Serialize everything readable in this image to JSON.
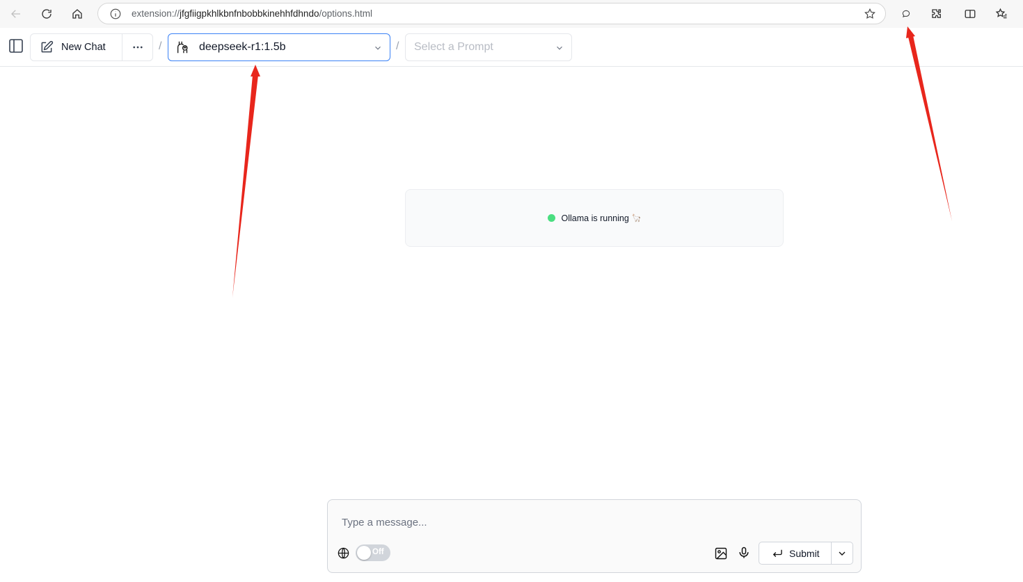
{
  "browser": {
    "url_prefix": "extension://",
    "url_host": "jfgfiigpkhlkbnfnbobbkinehhfdhndo",
    "url_path": "/options.html"
  },
  "header": {
    "new_chat_label": "New Chat",
    "breadcrumb_separator": "/",
    "model_label": "deepseek-r1:1.5b",
    "prompt_placeholder": "Select a Prompt"
  },
  "status": {
    "text": "Ollama is running",
    "emoji": "🦙",
    "color": "#4ade80"
  },
  "composer": {
    "placeholder": "Type a message...",
    "web_search_toggle_label": "Off",
    "submit_label": "Submit"
  },
  "colors": {
    "accent": "#3b82f6",
    "annotation_arrow": "#e8261c"
  },
  "icons": {
    "sidebar": "sidebar-icon",
    "new_chat": "pencil-square-icon",
    "more": "ellipsis-icon",
    "model": "llama-icon",
    "globe": "globe-icon",
    "image": "image-icon",
    "mic": "microphone-icon",
    "submit": "enter-arrow-icon"
  }
}
